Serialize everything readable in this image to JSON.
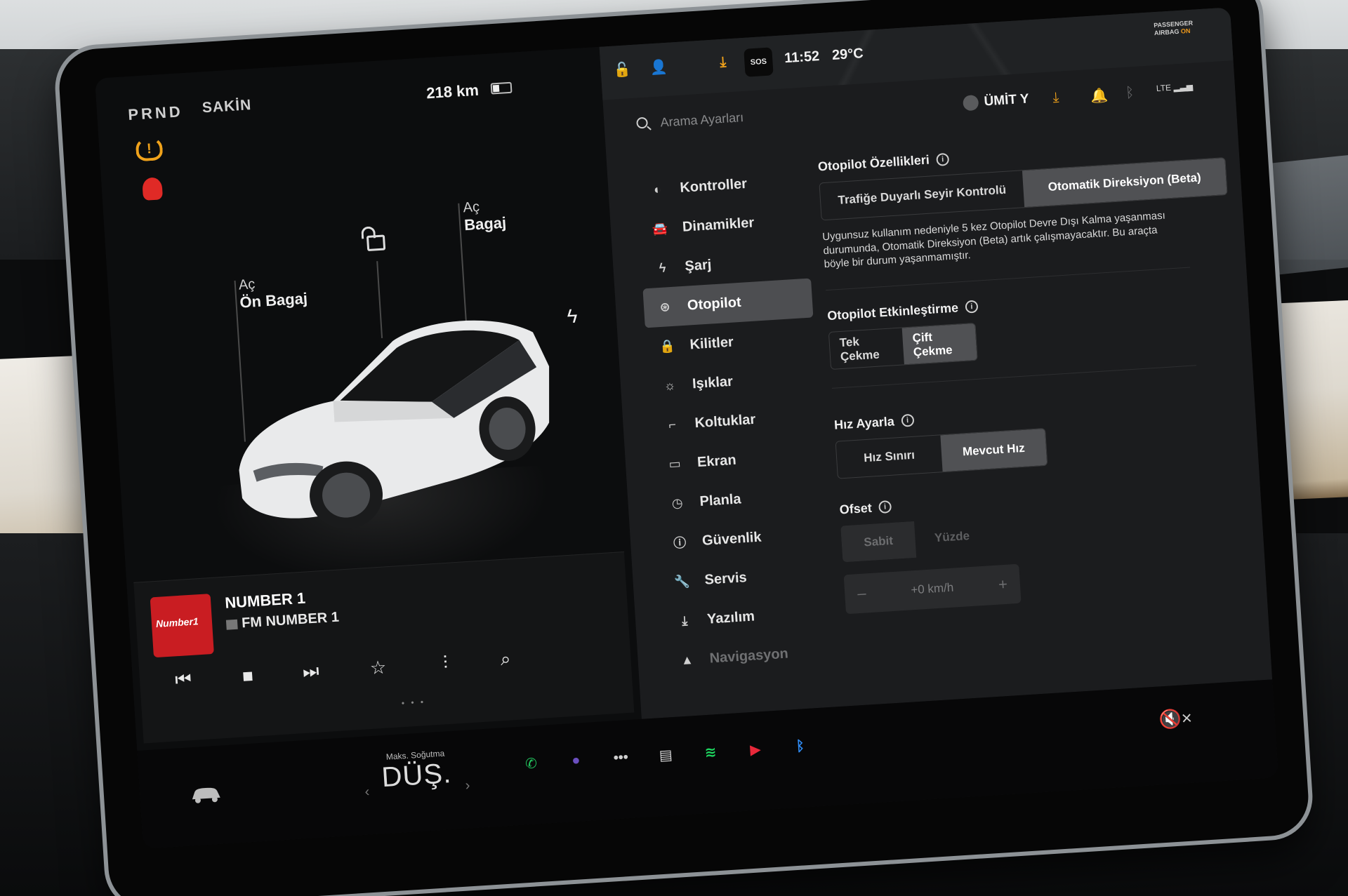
{
  "status": {
    "gears": "PRND",
    "drive_mode": "SAKİN",
    "range": "218 km",
    "time": "11:52",
    "temperature": "29°C",
    "sos": "SOS",
    "airbag_line1": "PASSENGER",
    "airbag_line2": "AIRBAG",
    "airbag_state": "ON"
  },
  "car": {
    "trunk_label_top": "Aç",
    "trunk_label": "Bagaj",
    "frunk_label_top": "Aç",
    "frunk_label": "Ön Bagaj",
    "body_color": "#e9eaeb",
    "warning_colors": {
      "tire": "#f0a21b",
      "seatbelt": "#e02a26"
    }
  },
  "media": {
    "station": "NUMBER 1",
    "source": "FM NUMBER 1",
    "album_text": "Number1",
    "album_color": "#c91d22"
  },
  "search": {
    "placeholder": "Arama Ayarları"
  },
  "header": {
    "user": "ÜMİT Y"
  },
  "menu": [
    {
      "label": "Kontroller",
      "icon": "toggle-icon"
    },
    {
      "label": "Dinamikler",
      "icon": "car-icon"
    },
    {
      "label": "Şarj",
      "icon": "bolt-icon"
    },
    {
      "label": "Otopilot",
      "icon": "steering-wheel-icon",
      "active": true
    },
    {
      "label": "Kilitler",
      "icon": "lock-icon"
    },
    {
      "label": "Işıklar",
      "icon": "sun-icon"
    },
    {
      "label": "Koltuklar",
      "icon": "seat-icon"
    },
    {
      "label": "Ekran",
      "icon": "display-icon"
    },
    {
      "label": "Planla",
      "icon": "clock-icon"
    },
    {
      "label": "Güvenlik",
      "icon": "info-circle-icon"
    },
    {
      "label": "Servis",
      "icon": "wrench-icon"
    },
    {
      "label": "Yazılım",
      "icon": "download-icon"
    },
    {
      "label": "Navigasyon",
      "icon": "navigation-icon"
    }
  ],
  "autopilot": {
    "features_title": "Otopilot Özellikleri",
    "features_options": [
      "Trafiğe Duyarlı Seyir Kontrolü",
      "Otomatik Direksiyon (Beta)"
    ],
    "features_selected": "Otomatik Direksiyon (Beta)",
    "warning_text": "Uygunsuz kullanım nedeniyle 5 kez Otopilot Devre Dışı Kalma yaşanması durumunda, Otomatik Direksiyon (Beta) artık çalışmayacaktır. Bu araçta böyle bir durum yaşanmamıştır.",
    "activation_title": "Otopilot Etkinleştirme",
    "activation_options": [
      "Tek Çekme",
      "Çift Çekme"
    ],
    "activation_selected": "Çift Çekme",
    "speed_title": "Hız Ayarla",
    "speed_options": [
      "Hız Sınırı",
      "Mevcut Hız"
    ],
    "speed_selected": "Mevcut Hız",
    "offset_title": "Ofset",
    "offset_options": [
      "Sabit",
      "Yüzde"
    ],
    "offset_selected": "Sabit",
    "offset_value": "+0 km/h",
    "minus": "–",
    "plus": "+"
  },
  "dock": {
    "climate_caption": "Maks. Soğutma",
    "climate_value": "DÜŞ.",
    "apps": [
      {
        "name": "phone",
        "glyph": "✆",
        "color": "#22c55e"
      },
      {
        "name": "camera",
        "glyph": "●",
        "color": "#6b4fbf"
      },
      {
        "name": "more",
        "glyph": "•••",
        "color": "#cfcfcf"
      },
      {
        "name": "notes",
        "glyph": "▤",
        "color": "#d8d8d8"
      },
      {
        "name": "spotify",
        "glyph": "≋",
        "color": "#1ed760"
      },
      {
        "name": "tunein",
        "glyph": "▶",
        "color": "#e8283a"
      },
      {
        "name": "bluetooth",
        "glyph": "ᛒ",
        "color": "#2f8cf5"
      }
    ],
    "mute": "🔇×"
  }
}
